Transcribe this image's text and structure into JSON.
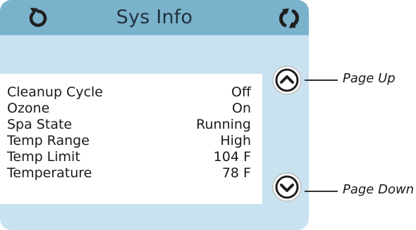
{
  "header": {
    "title": "Sys Info",
    "back_icon": "back-arrow-icon",
    "refresh_icon": "refresh-icon"
  },
  "rows": [
    {
      "label": "Cleanup Cycle",
      "value": "Off"
    },
    {
      "label": "Ozone",
      "value": "On"
    },
    {
      "label": "Spa State",
      "value": "Running"
    },
    {
      "label": "Temp Range",
      "value": "High"
    },
    {
      "label": "Temp Limit",
      "value": "104 F"
    },
    {
      "label": "Temperature",
      "value": "78 F"
    }
  ],
  "navigation": {
    "page_up_icon": "chevron-up-icon",
    "page_down_icon": "chevron-down-icon"
  },
  "callouts": {
    "page_up": "Page Up",
    "page_down": "Page Down"
  },
  "colors": {
    "header": "#7ab2cc",
    "screen_background": "#c9e2f0",
    "panel": "#ffffff",
    "icon": "#1e1e1e"
  }
}
